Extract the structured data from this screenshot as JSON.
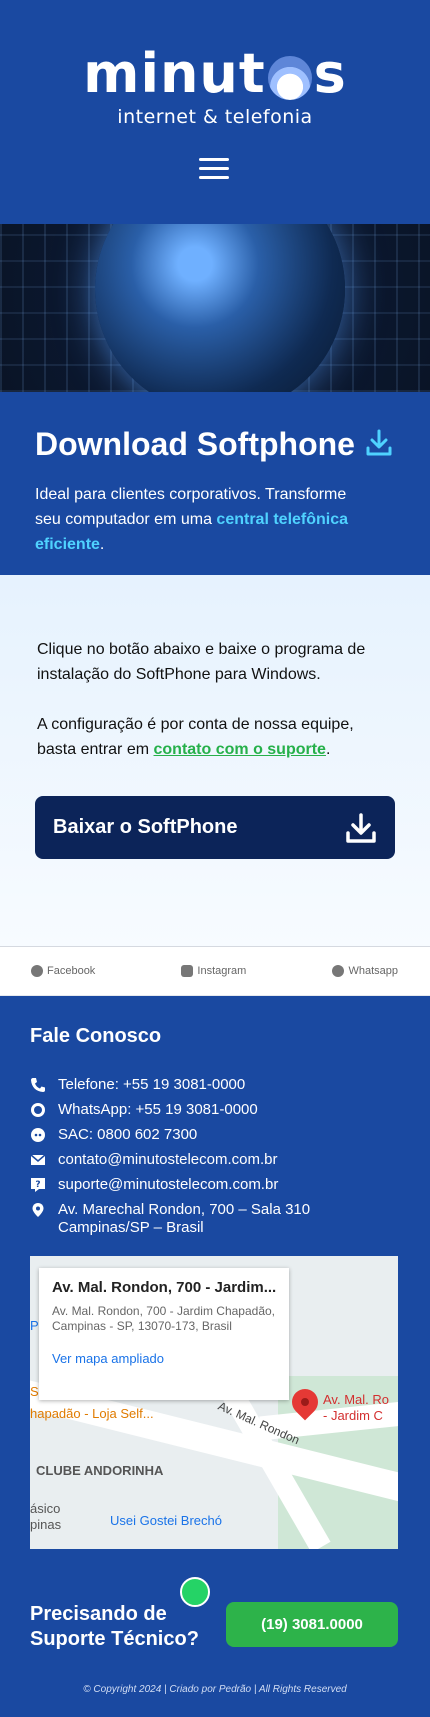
{
  "header": {
    "logo_text_1": "minut",
    "logo_text_2": "s",
    "logo_subtitle": "internet & telefonia"
  },
  "download": {
    "title": "Download Softphone",
    "desc_1": "Ideal para clientes corporativos. Transforme seu computador em uma ",
    "desc_accent": "central telefônica eficiente",
    "desc_end": "."
  },
  "content": {
    "para_1": "Clique no botão abaixo e baixe o programa de instalação do SoftPhone para Windows.",
    "para_2_start": "A configuração é por conta de nossa equipe, basta entrar em ",
    "para_2_link": "contato com o suporte",
    "para_2_end": ".",
    "button_label": "Baixar o SoftPhone"
  },
  "social": {
    "items": [
      "Facebook",
      "Instagram",
      "Whatsapp"
    ]
  },
  "footer": {
    "title": "Fale Conosco",
    "contacts": [
      "Telefone: +55 19 3081-0000",
      "WhatsApp: +55 19 3081-0000",
      "SAC: 0800 602 7300",
      "contato@minutostelecom.com.br",
      "suporte@minutostelecom.com.br",
      "Av. Marechal Rondon, 700 – Sala 310\nCampinas/SP – Brasil"
    ],
    "map": {
      "card_title": "Av. Mal. Rondon, 700 - Jardim...",
      "card_address": "Av. Mal. Rondon, 700 - Jardim Chapadão, Campinas - SP, 13070-173, Brasil",
      "card_link": "Ver mapa ampliado",
      "labels": [
        "hapadão - Loja Self...",
        "CLUBE ANDORINHA",
        "Av. Mal. Rondon",
        "Av. Mal. Ro",
        "- Jardim C",
        "Usei Gostei Brechó",
        "ásico",
        "pinas",
        "S",
        "P"
      ]
    },
    "support_text": "Precisando de Suporte Técnico?",
    "phone_button": "(19) 3081.0000",
    "copyright": "© Copyright 2024 | Criado por Pedrão | All Rights Reserved"
  },
  "colors": {
    "brand_blue": "#1a49a1",
    "dark_navy": "#0c2459",
    "accent_cyan": "#4fd2ff",
    "green": "#2db34a"
  }
}
